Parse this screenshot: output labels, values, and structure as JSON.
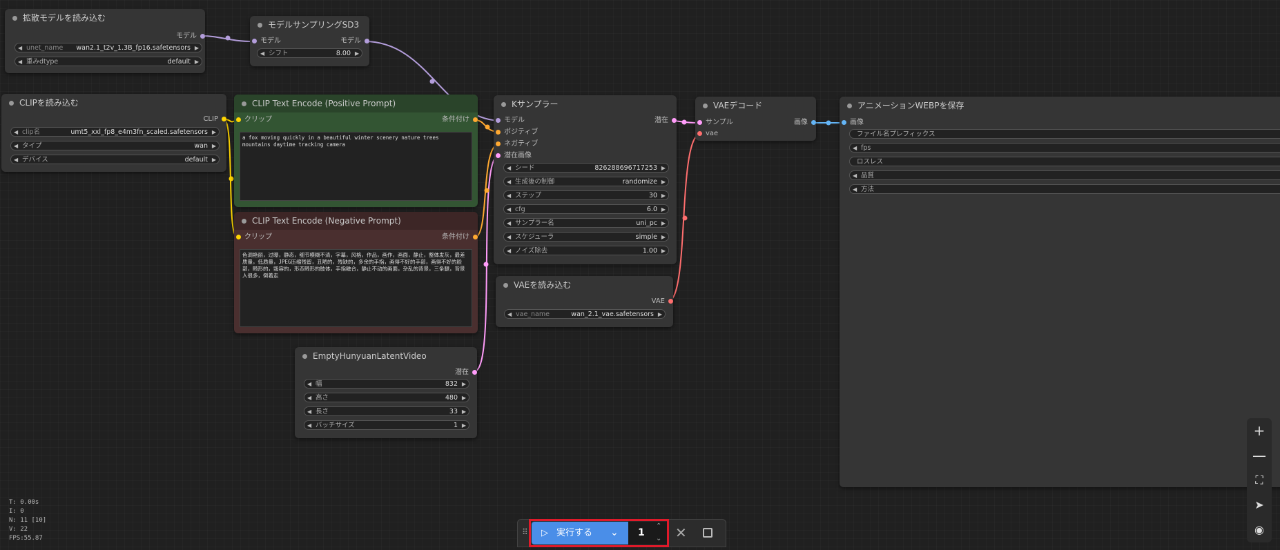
{
  "nodes": {
    "unet_loader": {
      "title": "拡散モデルを読み込む",
      "out_model": "モデル",
      "w_unet_label": "unet_name",
      "w_unet_value": "wan2.1_t2v_1.3B_fp16.safetensors",
      "w_dtype_label": "重みdtype",
      "w_dtype_value": "default"
    },
    "sampling": {
      "title": "モデルサンプリングSD3",
      "in_model": "モデル",
      "out_model": "モデル",
      "w_shift_label": "シフト",
      "w_shift_value": "8.00"
    },
    "clip_loader": {
      "title": "CLIPを読み込む",
      "out_clip": "CLIP",
      "w_clip_label": "clip名",
      "w_clip_value": "umt5_xxl_fp8_e4m3fn_scaled.safetensors",
      "w_type_label": "タイプ",
      "w_type_value": "wan",
      "w_device_label": "デバイス",
      "w_device_value": "default"
    },
    "pos": {
      "title": "CLIP Text Encode (Positive Prompt)",
      "in_clip": "クリップ",
      "out_cond": "条件付け",
      "text": "a fox moving quickly in a beautiful winter scenery nature trees mountains daytime tracking camera"
    },
    "neg": {
      "title": "CLIP Text Encode (Negative Prompt)",
      "in_clip": "クリップ",
      "out_cond": "条件付け",
      "text": "色调艳丽，过曝，静态，细节模糊不清，字幕，风格，作品，画作，画面，静止，整体发灰，最差质量，低质量，JPEG压缩残留，丑陋的，残缺的，多余的手指，画得不好的手部，画得不好的脸部，畸形的，毁容的，形态畸形的肢体，手指融合，静止不动的画面，杂乱的背景，三条腿，背景人很多，倒着走"
    },
    "ksampler": {
      "title": "Kサンプラー",
      "in_model": "モデル",
      "in_pos": "ポジティブ",
      "in_neg": "ネガティブ",
      "in_latent": "潜在画像",
      "out_latent": "潜在",
      "w_seed_label": "シード",
      "w_seed_value": "826288696717253",
      "w_ctrl_label": "生成後の制御",
      "w_ctrl_value": "randomize",
      "w_steps_label": "ステップ",
      "w_steps_value": "30",
      "w_cfg_label": "cfg",
      "w_cfg_value": "6.0",
      "w_sampler_label": "サンプラー名",
      "w_sampler_value": "uni_pc",
      "w_sched_label": "スケジューラ",
      "w_sched_value": "simple",
      "w_denoise_label": "ノイズ除去",
      "w_denoise_value": "1.00"
    },
    "vae_decode": {
      "title": "VAEデコード",
      "in_samples": "サンプル",
      "in_vae": "vae",
      "out_image": "画像"
    },
    "vae_loader": {
      "title": "VAEを読み込む",
      "out_vae": "VAE",
      "w_vae_label": "vae_name",
      "w_vae_value": "wan_2.1_vae.safetensors"
    },
    "save_webp": {
      "title": "アニメーションWEBPを保存",
      "in_images": "画像",
      "w_prefix": "ファイル名プレフィックス",
      "w_fps": "fps",
      "w_lossless": "ロスレス",
      "w_quality": "品質",
      "w_method": "方法"
    },
    "empty_latent": {
      "title": "EmptyHunyuanLatentVideo",
      "out_latent": "潜在",
      "w_width_label": "幅",
      "w_width_value": "832",
      "w_height_label": "高さ",
      "w_height_value": "480",
      "w_length_label": "長さ",
      "w_length_value": "33",
      "w_batch_label": "バッチサイズ",
      "w_batch_value": "1"
    }
  },
  "stats": {
    "t": "T: 0.00s",
    "i": "I: 0",
    "n": "N: 11 [10]",
    "v": "V: 22",
    "fps": "FPS:55.87"
  },
  "run_bar": {
    "run_label": "実行する",
    "count": "1"
  },
  "colors": {
    "model": "#b39ddb",
    "clip": "#ffd500",
    "cond": "#ffa931",
    "latent": "#ff9cf9",
    "vae": "#ff6e6e",
    "image": "#64b5f6"
  }
}
